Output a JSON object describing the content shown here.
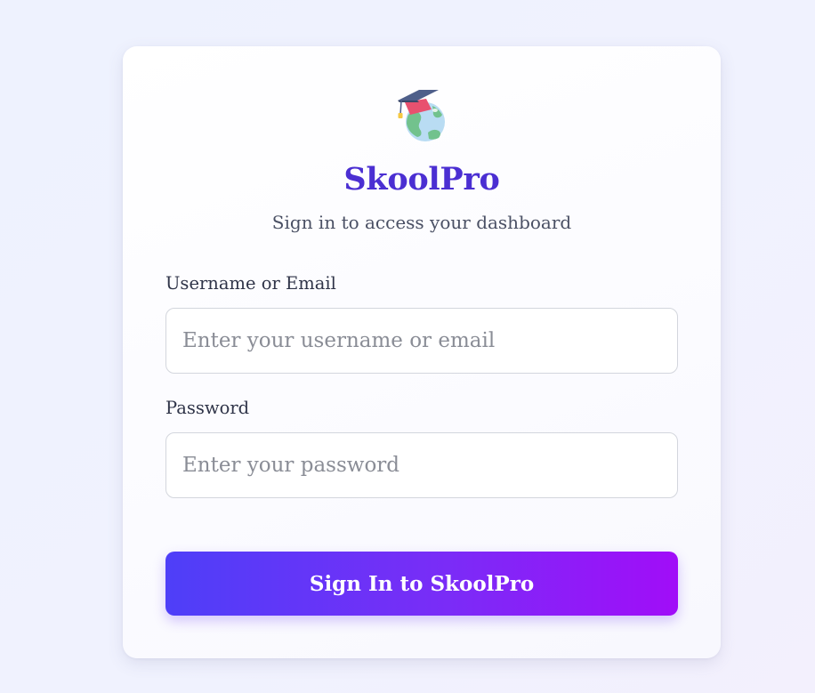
{
  "brand": {
    "icon": "graduation-globe-icon",
    "title": "SkoolPro",
    "subtitle": "Sign in to access your dashboard",
    "accent_color": "#4b2fd2"
  },
  "form": {
    "username_label": "Username or Email",
    "username_placeholder": "Enter your username or email",
    "password_label": "Password",
    "password_placeholder": "Enter your password",
    "submit_label": "Sign In to SkoolPro",
    "button_gradient": [
      "#4e3ff8",
      "#a10df8"
    ]
  }
}
